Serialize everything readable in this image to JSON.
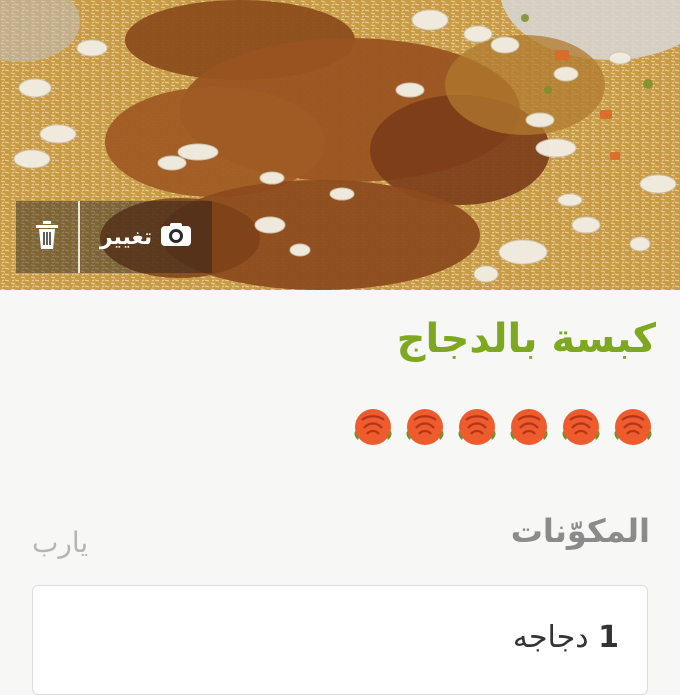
{
  "hero": {
    "image_alt": "kabsa chicken and rice photo"
  },
  "photo_toolbar": {
    "delete_icon": "trash-icon",
    "change_label": "تغيير",
    "change_icon": "camera-icon"
  },
  "recipe": {
    "title": "كبسة بالدجاج",
    "story_icons": [
      "rose",
      "rose",
      "rose",
      "rose",
      "rose",
      "rose"
    ],
    "servings": "يارب"
  },
  "ingredients": {
    "section_title": "المكوّنات",
    "items": [
      {
        "qty": "1",
        "name": "دجاجه"
      }
    ]
  },
  "colors": {
    "title_green": "#7ea81f",
    "section_gray": "#8b8b8b"
  }
}
